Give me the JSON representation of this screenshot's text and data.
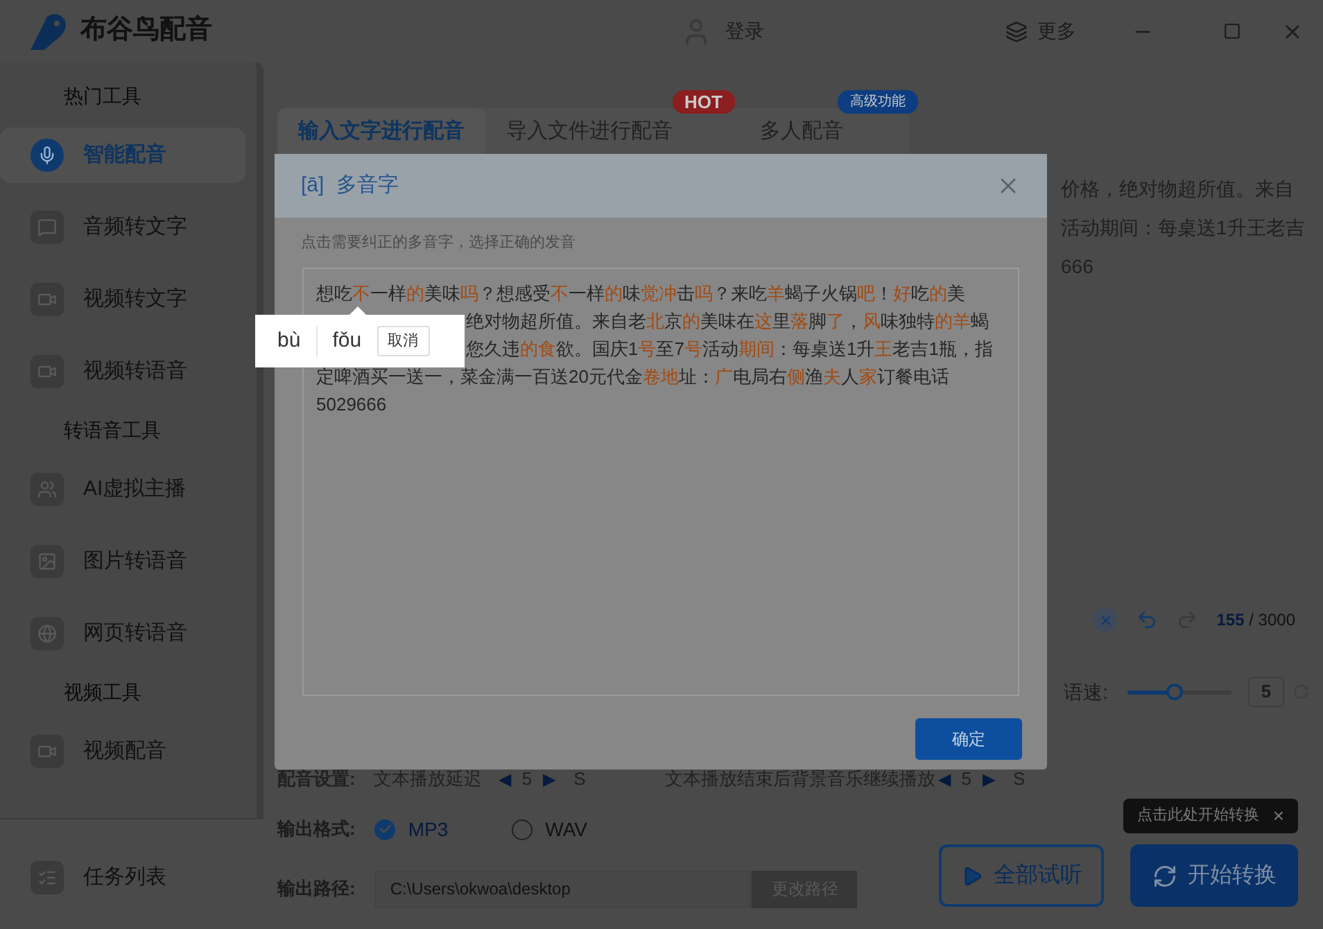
{
  "app": {
    "title": "布谷鸟配音",
    "login": "登录",
    "more": "更多"
  },
  "sidebar": {
    "sections": [
      {
        "title": "热门工具",
        "items": [
          {
            "label": "智能配音",
            "selected": true
          },
          {
            "label": "音频转文字",
            "selected": false
          },
          {
            "label": "视频转文字",
            "selected": false
          },
          {
            "label": "视频转语音",
            "selected": false
          }
        ]
      },
      {
        "title": "转语音工具",
        "items": [
          {
            "label": "AI虚拟主播",
            "selected": false
          },
          {
            "label": "图片转语音",
            "selected": false
          },
          {
            "label": "网页转语音",
            "selected": false
          }
        ]
      },
      {
        "title": "视频工具",
        "items": [
          {
            "label": "视频配音",
            "selected": false
          }
        ]
      }
    ],
    "footer_item": {
      "label": "任务列表",
      "selected": false
    }
  },
  "tabs": [
    {
      "label": "输入文字进行配音",
      "selected": true
    },
    {
      "label": "导入文件进行配音",
      "selected": false,
      "badge": "HOT"
    },
    {
      "label": "多人配音",
      "selected": false,
      "badge": "高级功能"
    }
  ],
  "editor": {
    "text_lines": [
      "价格，绝对物超所值。来自",
      "活动期间：每桌送1升王老吉",
      "666"
    ],
    "count": "155",
    "limit": "/ 3000"
  },
  "speed": {
    "label": "语速:",
    "level": 0.45,
    "value": "5"
  },
  "settings": {
    "label": "配音设置:",
    "delay_label": "文本播放延迟",
    "decrease": "◀",
    "increase": "▶",
    "delay_value": "5",
    "delay_unit": "S",
    "bgm_label": "文本播放结束后背景音乐继续播放",
    "bgm_value": "5",
    "bgm_unit": "S"
  },
  "format": {
    "label": "输出格式:",
    "options": [
      {
        "label": "MP3",
        "selected": true
      },
      {
        "label": "WAV",
        "selected": false
      }
    ]
  },
  "path": {
    "label": "输出路径:",
    "value": "C:\\Users\\okwoa\\desktop",
    "button": "更改路径"
  },
  "buttons": {
    "preview": "全部试听",
    "start": "开始转换"
  },
  "tooltip": {
    "text": "点击此处开始转换",
    "close": "×"
  },
  "dialog": {
    "icon": "[ā]",
    "title": "多音字",
    "hint": "点击需要纠正的多音字，选择正确的发音",
    "ok": "确定",
    "lines": [
      {
        "kind": "full",
        "segments": [
          {
            "text": "想吃",
            "kind": "plain"
          },
          {
            "text": "不",
            "kind": "polyphone"
          },
          {
            "text": "一样",
            "kind": "plain"
          },
          {
            "text": "的",
            "kind": "polyphone"
          },
          {
            "text": "美味",
            "kind": "plain"
          },
          {
            "text": "吗",
            "kind": "polyphone"
          },
          {
            "text": "？想感受",
            "kind": "plain"
          },
          {
            "text": "不",
            "kind": "polyphone"
          },
          {
            "text": "一样",
            "kind": "plain"
          },
          {
            "text": "的",
            "kind": "polyphone"
          },
          {
            "text": "味",
            "kind": "plain"
          },
          {
            "text": "觉冲",
            "kind": "polyphone"
          },
          {
            "text": "击",
            "kind": "plain"
          },
          {
            "text": "吗",
            "kind": "polyphone"
          },
          {
            "text": "？来吃",
            "kind": "plain"
          },
          {
            "text": "羊",
            "kind": "polyphone"
          },
          {
            "text": "蝎子火锅",
            "kind": "plain"
          },
          {
            "text": "吧",
            "kind": "polyphone"
          },
          {
            "text": "！",
            "kind": "plain"
          },
          {
            "text": "好",
            "kind": "polyphone"
          },
          {
            "text": "吃",
            "kind": "plain"
          },
          {
            "text": "的",
            "kind": "polyphone"
          },
          {
            "text": "美",
            "kind": "plain"
          }
        ]
      },
      {
        "kind": "covered",
        "segments": [
          {
            "text": "绝对物超所值。来自老",
            "kind": "plain"
          },
          {
            "text": "北",
            "kind": "polyphone"
          },
          {
            "text": "京",
            "kind": "plain"
          },
          {
            "text": "的",
            "kind": "polyphone"
          },
          {
            "text": "美味在",
            "kind": "plain"
          },
          {
            "text": "这",
            "kind": "polyphone"
          },
          {
            "text": "里",
            "kind": "plain"
          },
          {
            "text": "落",
            "kind": "polyphone"
          },
          {
            "text": "脚",
            "kind": "plain"
          },
          {
            "text": "了",
            "kind": "polyphone"
          },
          {
            "text": "，",
            "kind": "plain"
          },
          {
            "text": "风",
            "kind": "polyphone"
          },
          {
            "text": "味独特",
            "kind": "plain"
          },
          {
            "text": "的羊",
            "kind": "polyphone"
          },
          {
            "text": "蝎",
            "kind": "plain"
          }
        ]
      },
      {
        "kind": "covered",
        "segments": [
          {
            "text": "您久违",
            "kind": "plain"
          },
          {
            "text": "的食",
            "kind": "polyphone"
          },
          {
            "text": "欲。国庆1",
            "kind": "plain"
          },
          {
            "text": "号",
            "kind": "polyphone"
          },
          {
            "text": "至7",
            "kind": "plain"
          },
          {
            "text": "号",
            "kind": "polyphone"
          },
          {
            "text": "活动",
            "kind": "plain"
          },
          {
            "text": "期间",
            "kind": "polyphone"
          },
          {
            "text": "：每桌送1升",
            "kind": "plain"
          },
          {
            "text": "王",
            "kind": "polyphone"
          },
          {
            "text": "老吉1瓶，指",
            "kind": "plain"
          }
        ]
      },
      {
        "kind": "full",
        "segments": [
          {
            "text": "定啤酒买一送一，菜金满一百送20元代金",
            "kind": "plain"
          },
          {
            "text": "卷地",
            "kind": "polyphone"
          },
          {
            "text": "址：",
            "kind": "plain"
          },
          {
            "text": "广",
            "kind": "polyphone"
          },
          {
            "text": "电局右",
            "kind": "plain"
          },
          {
            "text": "侧",
            "kind": "polyphone"
          },
          {
            "text": "渔",
            "kind": "plain"
          },
          {
            "text": "夫",
            "kind": "polyphone"
          },
          {
            "text": "人",
            "kind": "plain"
          },
          {
            "text": "家",
            "kind": "polyphone"
          },
          {
            "text": "订餐电话",
            "kind": "plain"
          }
        ]
      },
      {
        "kind": "full",
        "segments": [
          {
            "text": "5029666",
            "kind": "plain"
          }
        ]
      }
    ],
    "popup": {
      "options": [
        "bù",
        "fǒu"
      ],
      "cancel": "取消"
    }
  }
}
